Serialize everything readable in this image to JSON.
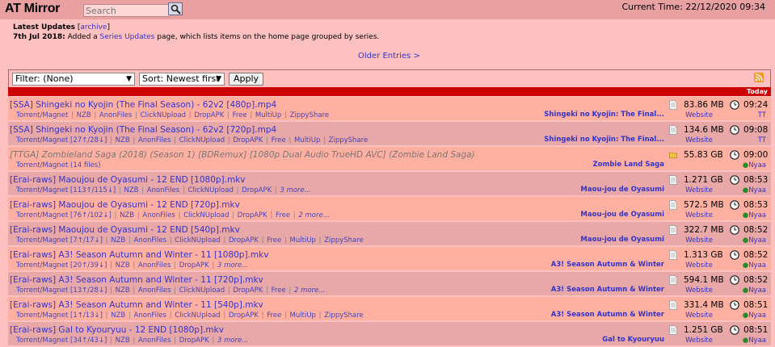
{
  "header": {
    "logo": "AT Mirror",
    "search_placeholder": "Search",
    "current_time": "Current Time: 22/12/2020 09:34"
  },
  "news": {
    "heading": "Latest Updates",
    "archive_link": "archive",
    "date": "7th Jul 2018:",
    "text_before": "Added a",
    "link_text": "Series Updates",
    "text_after": "page, which lists items on the home page grouped by series."
  },
  "older_entries": "Older Entries >",
  "filter": {
    "filter_value": "Filter: (None)",
    "sort_value": "Sort: Newest first",
    "apply_label": "Apply"
  },
  "day_label": "Today",
  "entries": [
    {
      "title": "[SSA] Shingeki no Kyojin (The Final Season) - 62v2 [480p].mp4",
      "grey": false,
      "links": [
        "Torrent/Magnet",
        "NZB",
        "AnonFiles",
        "ClickNUpload",
        "DropAPK",
        "Free",
        "MultiUp",
        "ZippyShare"
      ],
      "more": "",
      "series": "Shingeki no Kyojin: The Final...",
      "size": "83.86 MB",
      "icon": "file",
      "site": "Website",
      "time": "09:24",
      "submitter": "TT",
      "dot": false
    },
    {
      "title": "[SSA] Shingeki no Kyojin (The Final Season) - 62v2 [720p].mp4",
      "grey": false,
      "links": [
        "Torrent/Magnet [27↑/28↓]",
        "NZB",
        "AnonFiles",
        "ClickNUpload",
        "DropAPK",
        "Free",
        "MultiUp",
        "ZippyShare"
      ],
      "more": "",
      "series": "Shingeki no Kyojin: The Final...",
      "size": "134.6 MB",
      "icon": "file",
      "site": "Website",
      "time": "09:08",
      "submitter": "TT",
      "dot": false
    },
    {
      "title": "[TTGA] Zombieland Saga (2018) (Season 1) [BDRemux] [1080p Dual Audio TrueHD AVC] (Zombie Land Saga)",
      "grey": true,
      "links": [
        "Torrent/Magnet (14 files)"
      ],
      "more": "",
      "series": "Zombie Land Saga",
      "size": "55.83 GB",
      "icon": "folder",
      "site": "",
      "time": "09:00",
      "submitter": "Nyaa",
      "dot": true
    },
    {
      "title": "[Erai-raws] Maoujou de Oyasumi - 12 END [1080p].mkv",
      "grey": false,
      "links": [
        "Torrent/Magnet [113↑/115↓]",
        "NZB",
        "AnonFiles",
        "ClickNUpload",
        "DropAPK"
      ],
      "more": "3 more...",
      "series": "Maou-jou de Oyasumi",
      "size": "1.271 GB",
      "icon": "file",
      "site": "Website",
      "time": "08:53",
      "submitter": "Nyaa",
      "dot": true
    },
    {
      "title": "[Erai-raws] Maoujou de Oyasumi - 12 END [720p].mkv",
      "grey": false,
      "links": [
        "Torrent/Magnet [76↑/102↓]",
        "NZB",
        "AnonFiles",
        "ClickNUpload",
        "DropAPK",
        "Free"
      ],
      "more": "2 more...",
      "series": "Maou-jou de Oyasumi",
      "size": "572.5 MB",
      "icon": "file",
      "site": "Website",
      "time": "08:53",
      "submitter": "Nyaa",
      "dot": true
    },
    {
      "title": "[Erai-raws] Maoujou de Oyasumi - 12 END [540p].mkv",
      "grey": false,
      "links": [
        "Torrent/Magnet [7↑/17↓]",
        "NZB",
        "AnonFiles",
        "ClickNUpload",
        "DropAPK",
        "Free",
        "MultiUp",
        "ZippyShare"
      ],
      "more": "",
      "series": "Maou-jou de Oyasumi",
      "size": "322.7 MB",
      "icon": "file",
      "site": "Website",
      "time": "08:52",
      "submitter": "Nyaa",
      "dot": true
    },
    {
      "title": "[Erai-raws] A3! Season Autumn and Winter - 11 [1080p].mkv",
      "grey": false,
      "links": [
        "Torrent/Magnet [20↑/39↓]",
        "NZB",
        "AnonFiles",
        "DropAPK"
      ],
      "more": "3 more...",
      "series": "A3! Season Autumn & Winter",
      "size": "1.313 GB",
      "icon": "file",
      "site": "Website",
      "time": "08:52",
      "submitter": "Nyaa",
      "dot": true
    },
    {
      "title": "[Erai-raws] A3! Season Autumn and Winter - 11 [720p].mkv",
      "grey": false,
      "links": [
        "Torrent/Magnet [13↑/28↓]",
        "NZB",
        "AnonFiles",
        "ClickNUpload",
        "DropAPK",
        "Free"
      ],
      "more": "2 more...",
      "series": "A3! Season Autumn & Winter",
      "size": "594.1 MB",
      "icon": "file",
      "site": "Website",
      "time": "08:52",
      "submitter": "Nyaa",
      "dot": true
    },
    {
      "title": "[Erai-raws] A3! Season Autumn and Winter - 11 [540p].mkv",
      "grey": false,
      "links": [
        "Torrent/Magnet [1↑/13↓]",
        "NZB",
        "AnonFiles",
        "ClickNUpload",
        "DropAPK",
        "Free",
        "MultiUp",
        "ZippyShare"
      ],
      "more": "",
      "series": "A3! Season Autumn & Winter",
      "size": "331.4 MB",
      "icon": "file",
      "site": "Website",
      "time": "08:51",
      "submitter": "Nyaa",
      "dot": true
    },
    {
      "title": "[Erai-raws] Gal to Kyouryuu - 12 END [1080p].mkv",
      "grey": false,
      "links": [
        "Torrent/Magnet [34↑/43↓]",
        "NZB",
        "AnonFiles",
        "DropAPK"
      ],
      "more": "3 more...",
      "series": "Gal to Kyouryuu",
      "size": "1.251 GB",
      "icon": "file",
      "site": "Website",
      "time": "08:51",
      "submitter": "Nyaa",
      "dot": true
    }
  ]
}
